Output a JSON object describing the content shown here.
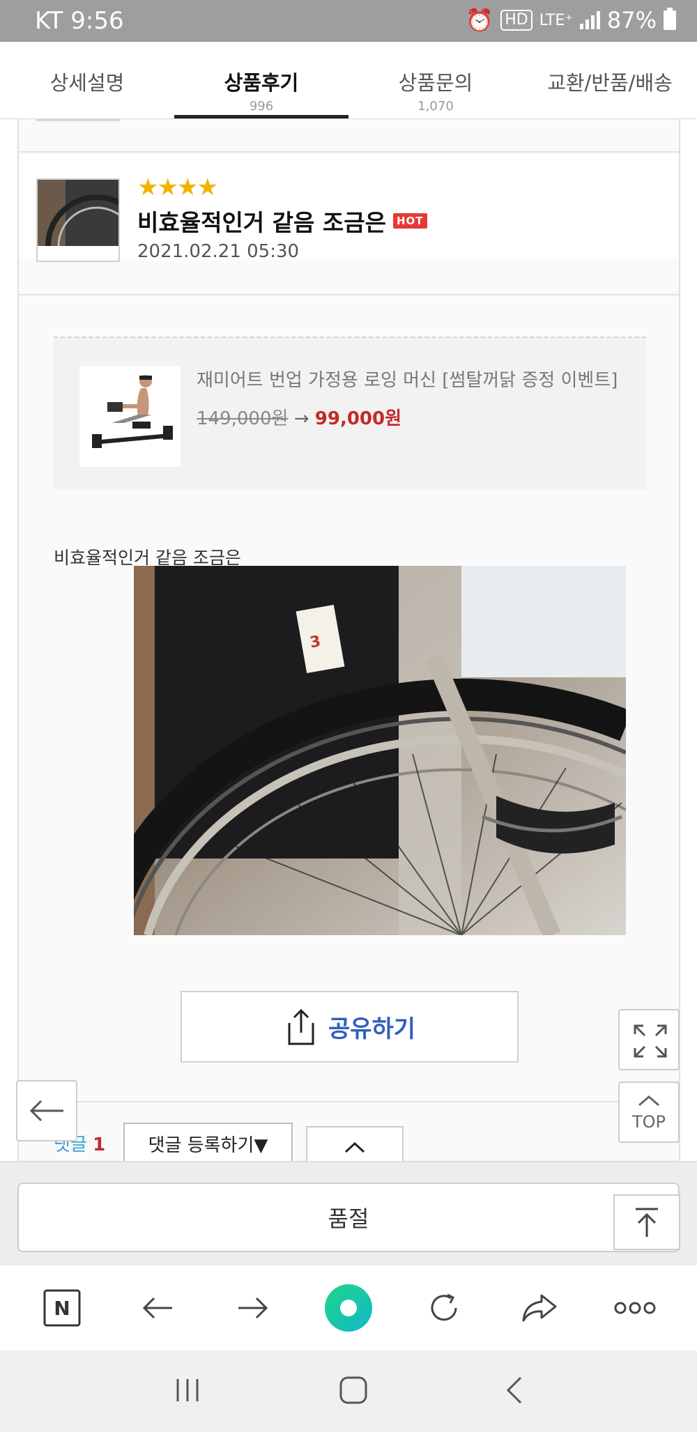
{
  "status_bar": {
    "carrier_time": "KT 9:56",
    "hd": "HD",
    "network": "LTE⁺",
    "battery": "87%"
  },
  "tabs": [
    {
      "label": "상세설명",
      "count": ""
    },
    {
      "label": "상품후기",
      "count": "996"
    },
    {
      "label": "상품문의",
      "count": "1,070"
    },
    {
      "label": "교환/반품/배송",
      "count": ""
    }
  ],
  "review": {
    "rating": "★★★★",
    "rating_value": 4,
    "title": "비효율적인거 같음 조금은",
    "badge": "HOT",
    "date": "2021.02.21 05:30",
    "body": "비효율적인거 같음 조금은"
  },
  "product": {
    "name": "재미어트 번업 가정용 로잉 머신 [썸탈꺼닭 증정 이벤트]",
    "old_price": "149,000원",
    "arrow": "→",
    "new_price": "99,000원"
  },
  "share": {
    "label": "공유하기"
  },
  "comments": {
    "label": "댓글",
    "count": "1",
    "register": "댓글 등록하기▼",
    "collapse": "^"
  },
  "floating": {
    "top_label": "TOP"
  },
  "purchase": {
    "soldout_label": "품절"
  },
  "browser": {
    "naver_label": "N"
  },
  "colors": {
    "accent_blue": "#2f5fbf",
    "price_red": "#c62828",
    "star_gold": "#f0b400",
    "hot_red": "#e53935",
    "comment_blue": "#3aa0d0",
    "home_green": "#1ed48a"
  }
}
